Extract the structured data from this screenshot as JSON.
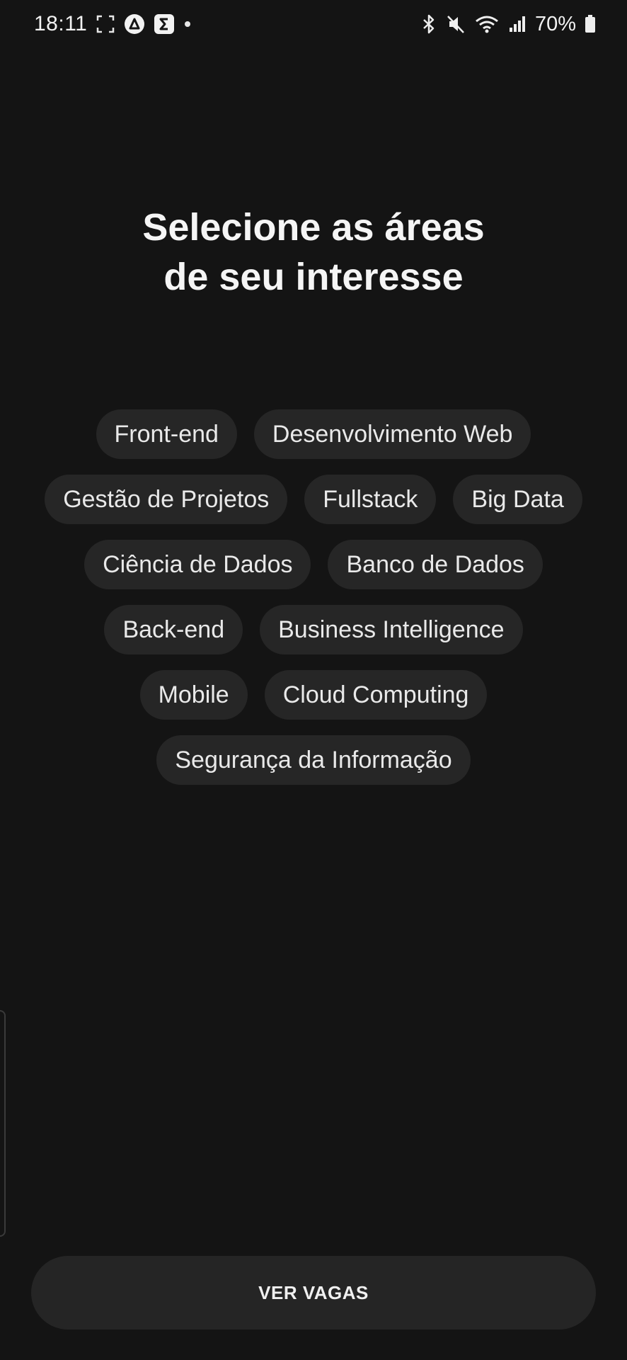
{
  "status_bar": {
    "time": "18:11",
    "battery_percent": "70%",
    "left_icons": [
      "screenshot-frame-icon",
      "app-a-icon",
      "sigma-icon",
      "dot-icon"
    ],
    "right_icons": [
      "bluetooth-icon",
      "mute-icon",
      "wifi-icon",
      "signal-icon",
      "battery-icon"
    ]
  },
  "header": {
    "title_line1": "Selecione as áreas",
    "title_line2": "de seu interesse"
  },
  "interests": [
    "Front-end",
    "Desenvolvimento Web",
    "Gestão de Projetos",
    "Fullstack",
    "Big Data",
    "Ciência de Dados",
    "Banco de Dados",
    "Back-end",
    "Business Intelligence",
    "Mobile",
    "Cloud Computing",
    "Segurança da Informação"
  ],
  "actions": {
    "primary_label": "VER VAGAS"
  },
  "colors": {
    "background": "#141414",
    "chip": "#262626",
    "button": "#252525",
    "text": "#ffffff"
  }
}
